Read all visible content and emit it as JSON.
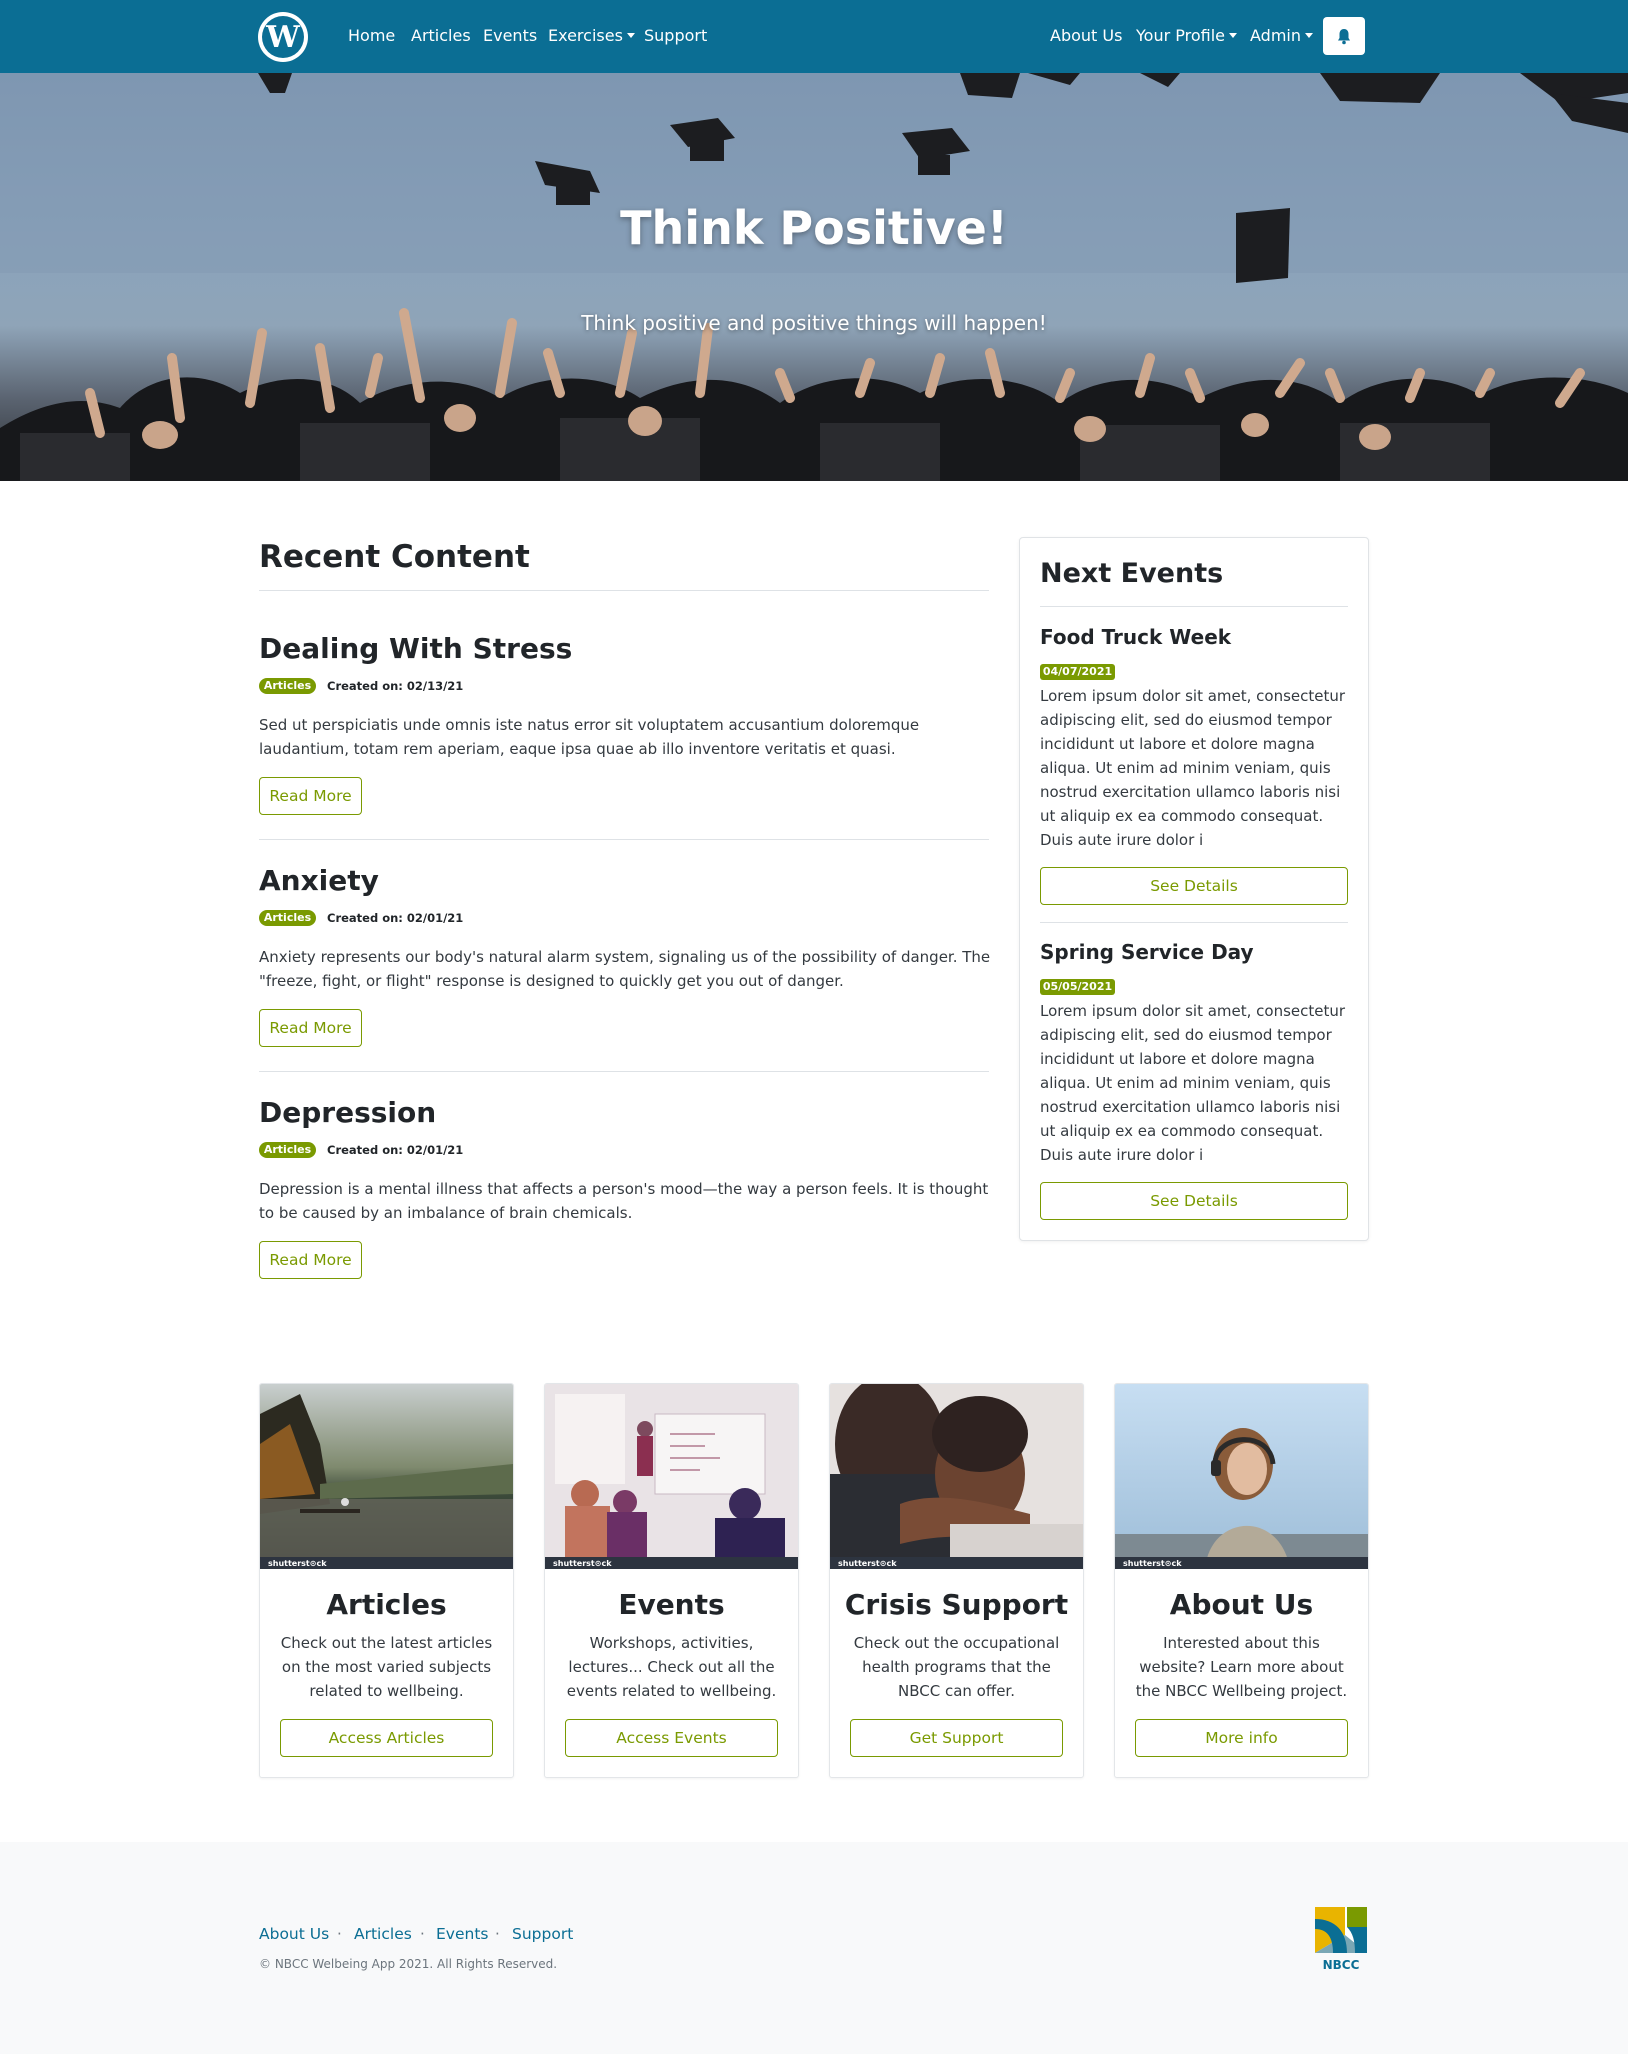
{
  "navbar": {
    "logo_glyph": "W",
    "links": {
      "home": "Home",
      "articles": "Articles",
      "events": "Events",
      "exercises": "Exercises",
      "support": "Support"
    },
    "right_links": {
      "about": "About Us",
      "profile": "Your Profile",
      "admin": "Admin"
    },
    "bell_icon": "bell-icon",
    "background_color": "#0b6e94"
  },
  "hero": {
    "title": "Think Positive!",
    "subtitle": "Think positive and positive things will happen!"
  },
  "recent": {
    "heading": "Recent Content",
    "posts": [
      {
        "title": "Dealing With Stress",
        "badge": "Articles",
        "meta": "Created on: 02/13/21",
        "text": "Sed ut perspiciatis unde omnis iste natus error sit voluptatem accusantium doloremque laudantium, totam rem aperiam, eaque ipsa quae ab illo inventore veritatis et quasi.",
        "button": "Read More"
      },
      {
        "title": "Anxiety",
        "badge": "Articles",
        "meta": "Created on: 02/01/21",
        "text": "Anxiety represents our body's natural alarm system, signaling us of the possibility of danger. The \"freeze, fight, or flight\" response is designed to quickly get you out of danger.",
        "button": "Read More"
      },
      {
        "title": "Depression",
        "badge": "Articles",
        "meta": "Created on: 02/01/21",
        "text": "Depression is a mental illness that affects a person's mood—the way a person feels. It is thought to be caused by an imbalance of brain chemicals.",
        "button": "Read More"
      }
    ]
  },
  "events": {
    "heading": "Next Events",
    "items": [
      {
        "title": "Food Truck Week",
        "date": "04/07/2021",
        "text": "Lorem ipsum dolor sit amet, consectetur adipiscing elit, sed do eiusmod tempor incididunt ut labore et dolore magna aliqua. Ut enim ad minim veniam, quis nostrud exercitation ullamco laboris nisi ut aliquip ex ea commodo consequat. Duis aute irure dolor i",
        "button": "See Details"
      },
      {
        "title": "Spring Service Day",
        "date": "05/05/2021",
        "text": "Lorem ipsum dolor sit amet, consectetur adipiscing elit, sed do eiusmod tempor incididunt ut labore et dolore magna aliqua. Ut enim ad minim veniam, quis nostrud exercitation ullamco laboris nisi ut aliquip ex ea commodo consequat. Duis aute irure dolor i",
        "button": "See Details"
      }
    ]
  },
  "features": [
    {
      "title": "Articles",
      "text": "Check out the latest articles on the most varied subjects related to wellbeing.",
      "button": "Access Articles",
      "watermark": "shutterst⊙ck"
    },
    {
      "title": "Events",
      "text": "Workshops, activities, lectures... Check out all the events related to wellbeing.",
      "button": "Access Events",
      "watermark": "shutterst⊙ck"
    },
    {
      "title": "Crisis Support",
      "text": "Check out the occupational health programs that the NBCC can offer.",
      "button": "Get Support",
      "watermark": "shutterst⊙ck"
    },
    {
      "title": "About Us",
      "text": "Interested about this website? Learn more about the NBCC Wellbeing project.",
      "button": "More info",
      "watermark": "shutterst⊙ck"
    }
  ],
  "footer": {
    "links": [
      "About Us",
      "Articles",
      "Events",
      "Support"
    ],
    "separator": "·",
    "copyright": "© NBCC Welbeing App 2021. All Rights Reserved.",
    "logo_text": "NBCC"
  },
  "colors": {
    "accent": "#7a9a01",
    "link": "#0b6e94",
    "footer_bg": "#f8f9fa"
  }
}
